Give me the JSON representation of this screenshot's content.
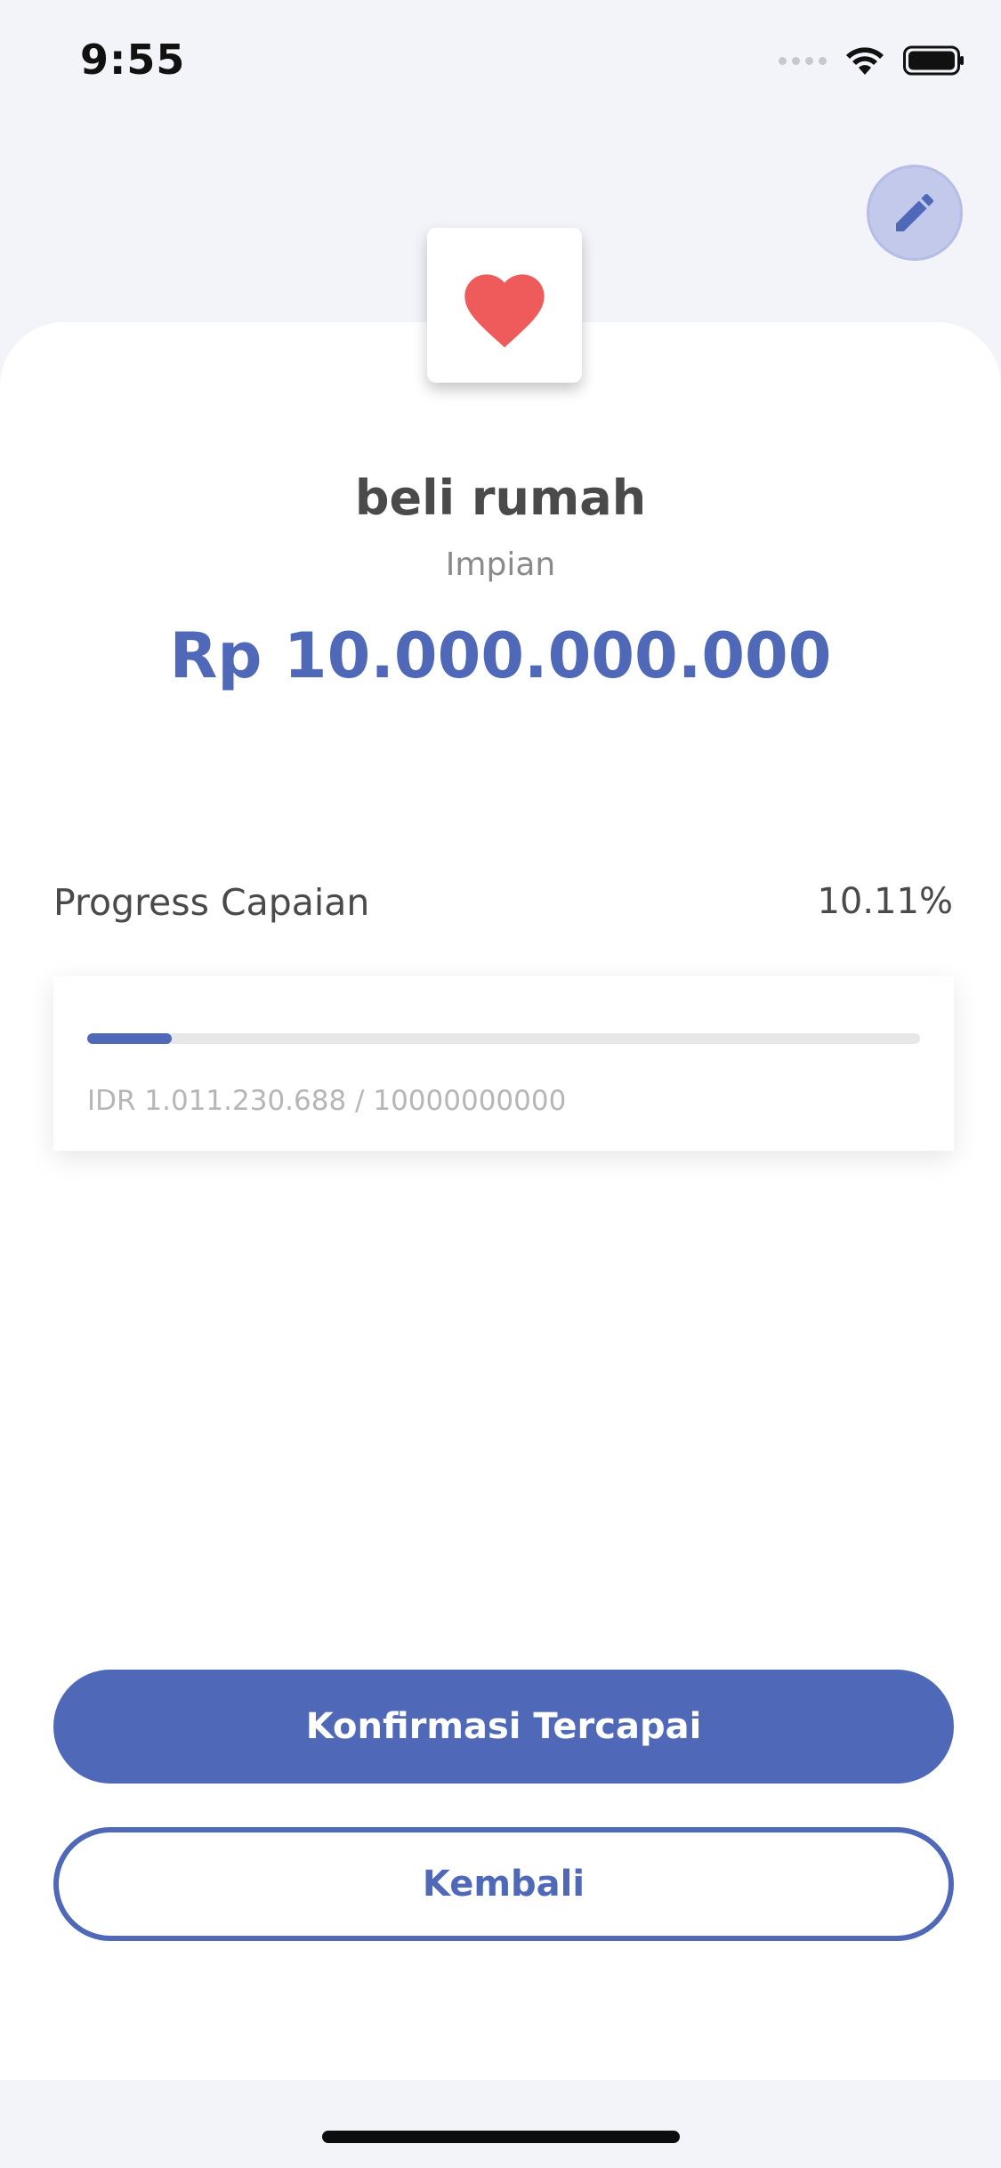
{
  "status_bar": {
    "time": "9:55",
    "signal_icon": "cellular-signal-icon",
    "wifi_icon": "wifi-icon",
    "battery_icon": "battery-icon"
  },
  "header": {
    "edit_icon": "pencil-icon"
  },
  "goal": {
    "icon": "heart-icon",
    "icon_color": "#ef5a5a",
    "title": "beli rumah",
    "category": "Impian",
    "amount": "Rp 10.000.000.000"
  },
  "progress": {
    "label": "Progress Capaian",
    "percent_text": "10.11%",
    "fraction": 0.1011,
    "amount_text": "IDR 1.011.230.688 / 10000000000"
  },
  "actions": {
    "confirm_label": "Konfirmasi Tercapai",
    "back_label": "Kembali"
  },
  "colors": {
    "accent": "#4f68b8",
    "background": "#f3f4f9",
    "heart": "#ef5a5a"
  }
}
